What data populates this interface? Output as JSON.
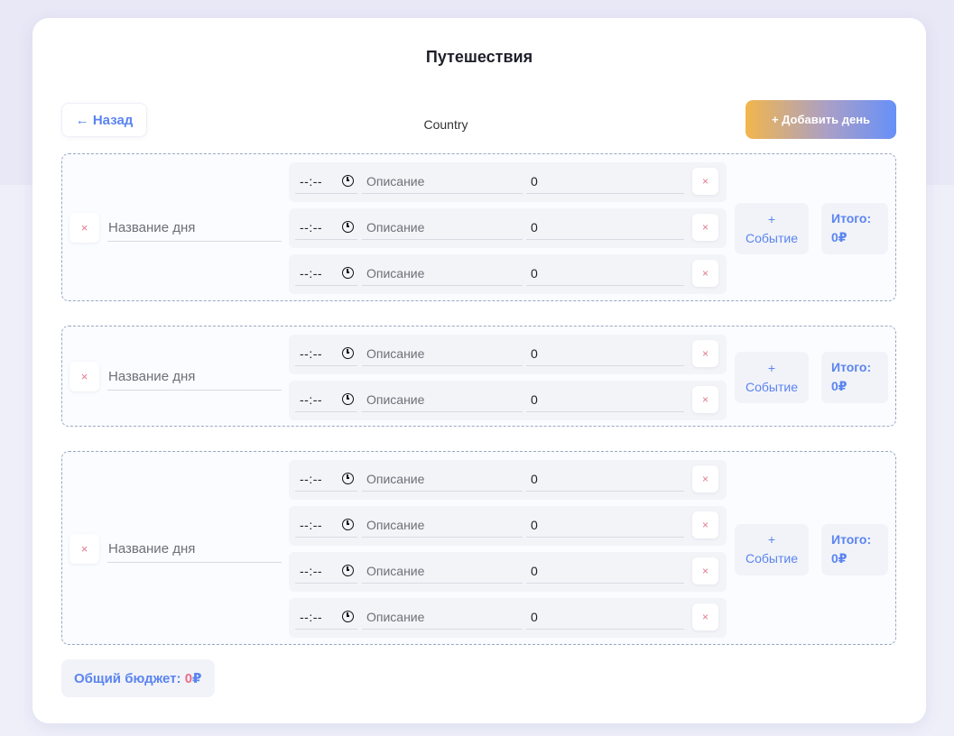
{
  "page": {
    "title": "Путешествия",
    "back_label": "← Назад",
    "country": "Country",
    "add_day_label": "+ Добавить день"
  },
  "common": {
    "remove_symbol": "×",
    "time_placeholder": "--:--",
    "day_name_placeholder": "Название дня",
    "description_placeholder": "Описание",
    "add_event_plus": "+",
    "add_event_label": "Событие",
    "total_label": "Итого:"
  },
  "days": [
    {
      "name": "",
      "total": "0₽",
      "events": [
        {
          "time": "",
          "description": "",
          "amount": "0"
        },
        {
          "time": "",
          "description": "",
          "amount": "0"
        },
        {
          "time": "",
          "description": "",
          "amount": "0"
        }
      ]
    },
    {
      "name": "",
      "total": "0₽",
      "events": [
        {
          "time": "",
          "description": "",
          "amount": "0"
        },
        {
          "time": "",
          "description": "",
          "amount": "0"
        }
      ]
    },
    {
      "name": "",
      "total": "0₽",
      "events": [
        {
          "time": "",
          "description": "",
          "amount": "0"
        },
        {
          "time": "",
          "description": "",
          "amount": "0"
        },
        {
          "time": "",
          "description": "",
          "amount": "0"
        },
        {
          "time": "",
          "description": "",
          "amount": "0"
        }
      ]
    }
  ],
  "budget": {
    "label": "Общий бюджет:",
    "value": "0",
    "currency": "₽"
  },
  "colors": {
    "accent_blue": "#5b84f0",
    "accent_pink": "#e86e8a",
    "gradient_start": "#f2b64c",
    "gradient_end": "#6690f8"
  }
}
